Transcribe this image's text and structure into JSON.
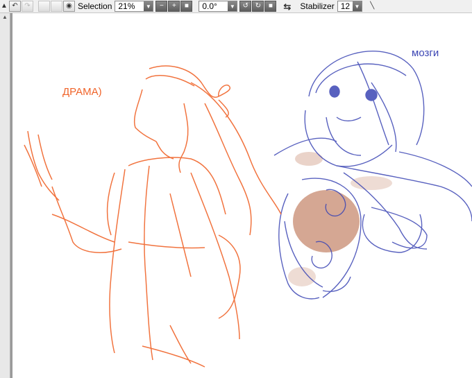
{
  "toolbar": {
    "selection_label": "Selection",
    "zoom_value": "21%",
    "rotation_value": "0.0°",
    "stabilizer_label": "Stabilizer",
    "stabilizer_value": "12"
  },
  "canvas": {
    "annotation_left": "ДРАМА)",
    "annotation_right": "мозги"
  },
  "colors": {
    "orange_sketch": "#f0642a",
    "blue_sketch": "#3c46b4",
    "brown_fill": "#b4603c"
  },
  "icons": {
    "undo": "undo-icon",
    "redo": "redo-icon",
    "view": "eye-icon",
    "zoom_out": "minus-icon",
    "zoom_in": "plus-icon",
    "zoom_reset": "square-icon",
    "rotate_left": "rotate-ccw-icon",
    "rotate_right": "rotate-cw-icon",
    "rotate_reset": "square-icon",
    "flip": "flip-icon",
    "pen": "pen-line-icon"
  }
}
